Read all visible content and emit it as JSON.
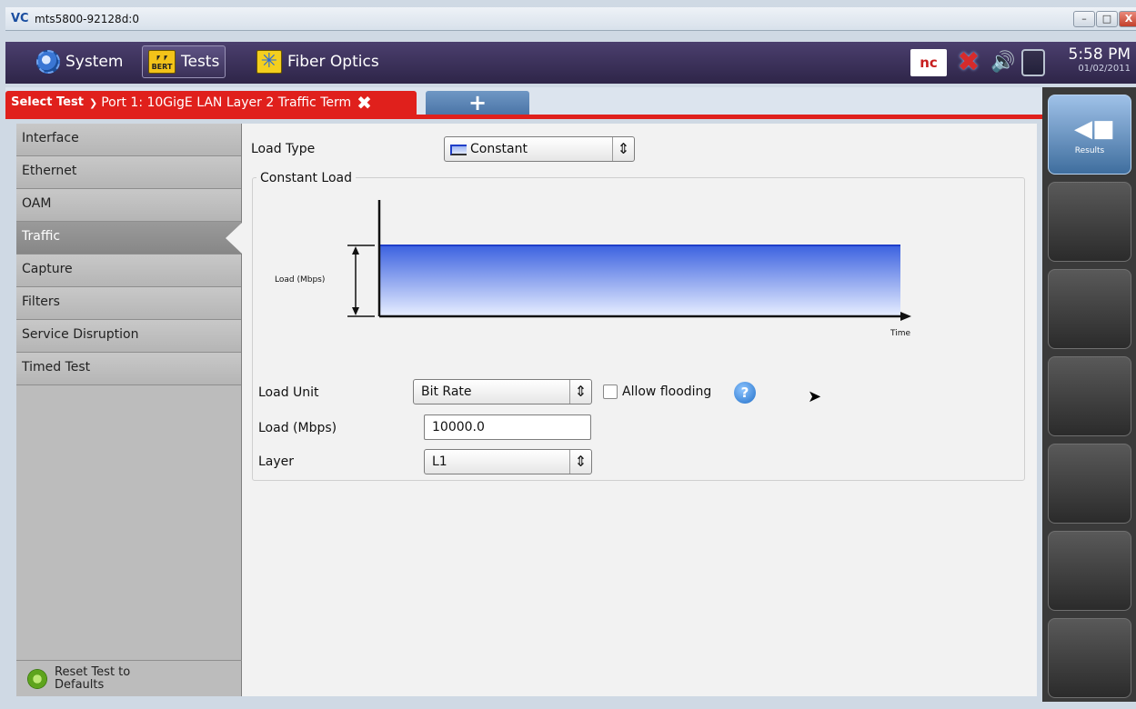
{
  "window": {
    "app_icon": "VC",
    "title": "mts5800-92128d:0",
    "min": "–",
    "max": "□",
    "close": "X"
  },
  "topbar": {
    "system_label": "System",
    "tests_label": "Tests",
    "bert_badge": "BERT",
    "fiber_label": "Fiber Optics",
    "nc_label": "nc",
    "time": "5:58 PM",
    "date": "01/02/2011"
  },
  "tabs": {
    "select_test": "Select Test",
    "port_label": "Port 1: 10GigE LAN Layer 2 Traffic Term",
    "add": "+"
  },
  "sidebar": {
    "items": [
      {
        "label": "Interface"
      },
      {
        "label": "Ethernet"
      },
      {
        "label": "OAM"
      },
      {
        "label": "Traffic"
      },
      {
        "label": "Capture"
      },
      {
        "label": "Filters"
      },
      {
        "label": "Service Disruption"
      },
      {
        "label": "Timed Test"
      }
    ],
    "active_index": 3,
    "reset_label": "Reset Test to Defaults"
  },
  "content": {
    "load_type_label": "Load Type",
    "load_type_value": "Constant",
    "group_title": "Constant Load",
    "chart_y_label": "Load (Mbps)",
    "chart_x_label": "Time",
    "load_unit_label": "Load Unit",
    "load_unit_value": "Bit Rate",
    "allow_flooding_label": "Allow flooding",
    "allow_flooding_checked": false,
    "load_label": "Load (Mbps)",
    "load_value": "10000.0",
    "layer_label": "Layer",
    "layer_value": "L1"
  },
  "rightpanel": {
    "results_label": "Results"
  },
  "colors": {
    "accent_red": "#e0201c",
    "chart_blue": "#1f3ec9",
    "topbar": "#3a3158"
  }
}
